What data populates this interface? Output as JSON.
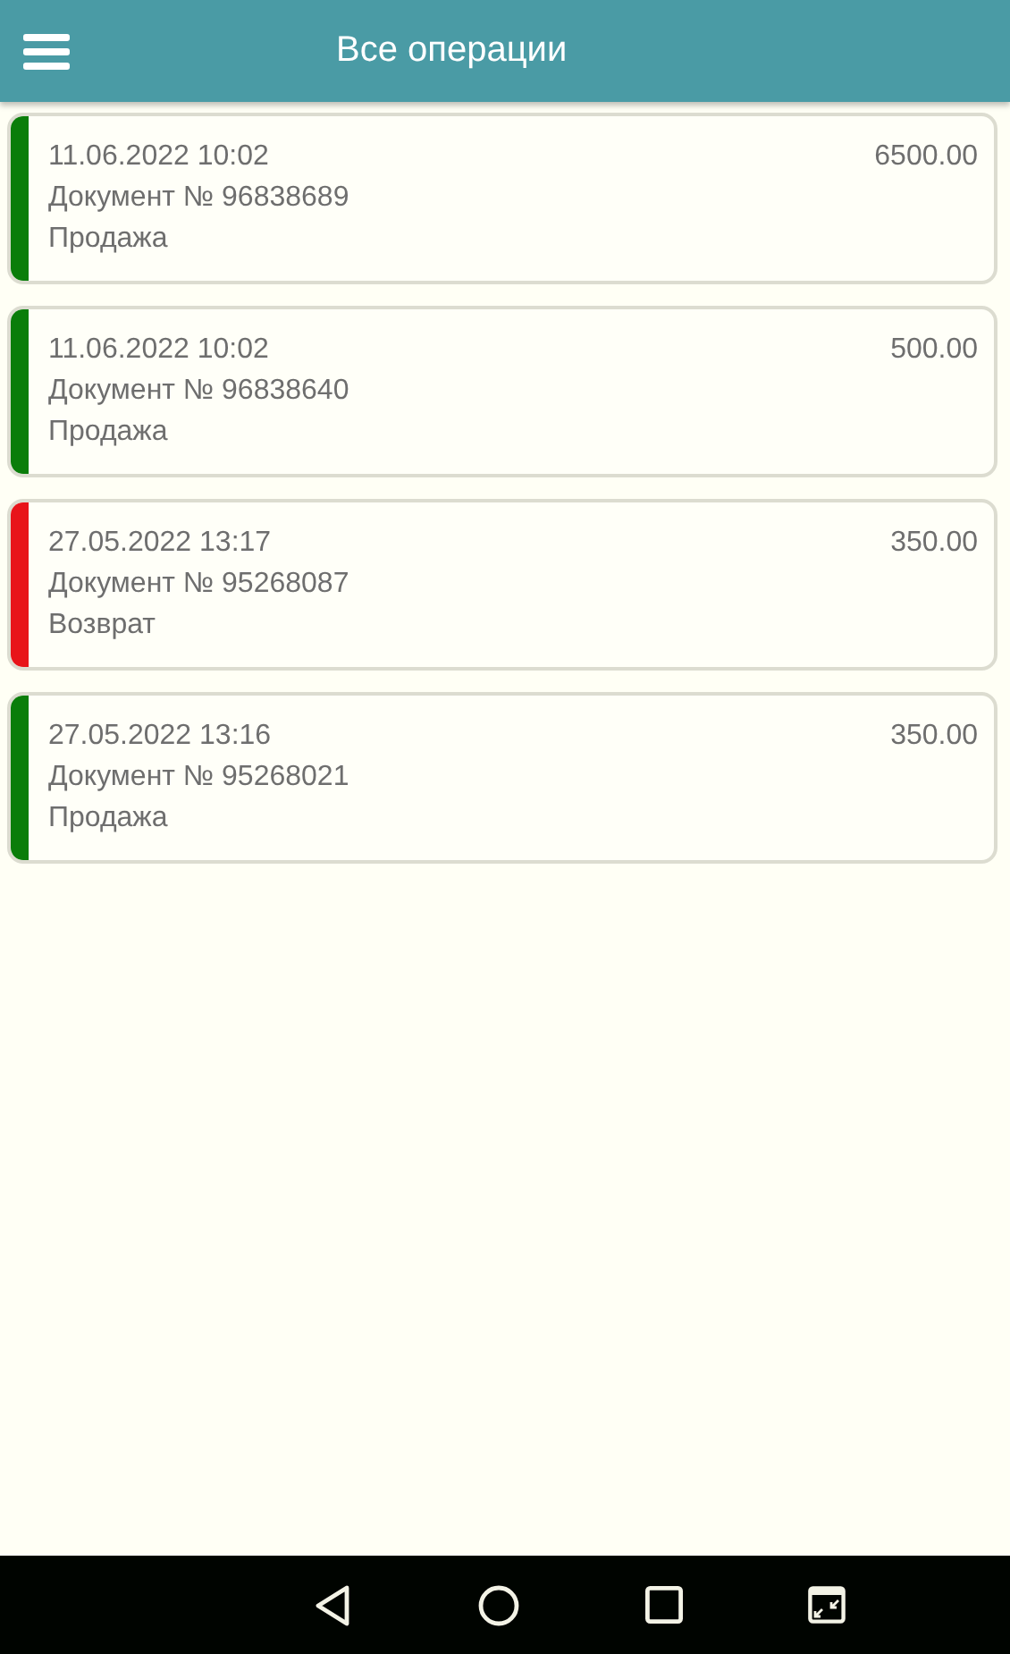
{
  "header": {
    "title": "Все операции"
  },
  "operations": [
    {
      "datetime": "11.06.2022 10:02",
      "amount": "6500.00",
      "document": "Документ № 96838689",
      "type": "Продажа",
      "color": "#0a7d0a"
    },
    {
      "datetime": "11.06.2022 10:02",
      "amount": "500.00",
      "document": "Документ № 96838640",
      "type": "Продажа",
      "color": "#0a7d0a"
    },
    {
      "datetime": "27.05.2022 13:17",
      "amount": "350.00",
      "document": "Документ № 95268087",
      "type": "Возврат",
      "color": "#e8141a"
    },
    {
      "datetime": "27.05.2022 13:16",
      "amount": "350.00",
      "document": "Документ № 95268021",
      "type": "Продажа",
      "color": "#0a7d0a"
    }
  ]
}
